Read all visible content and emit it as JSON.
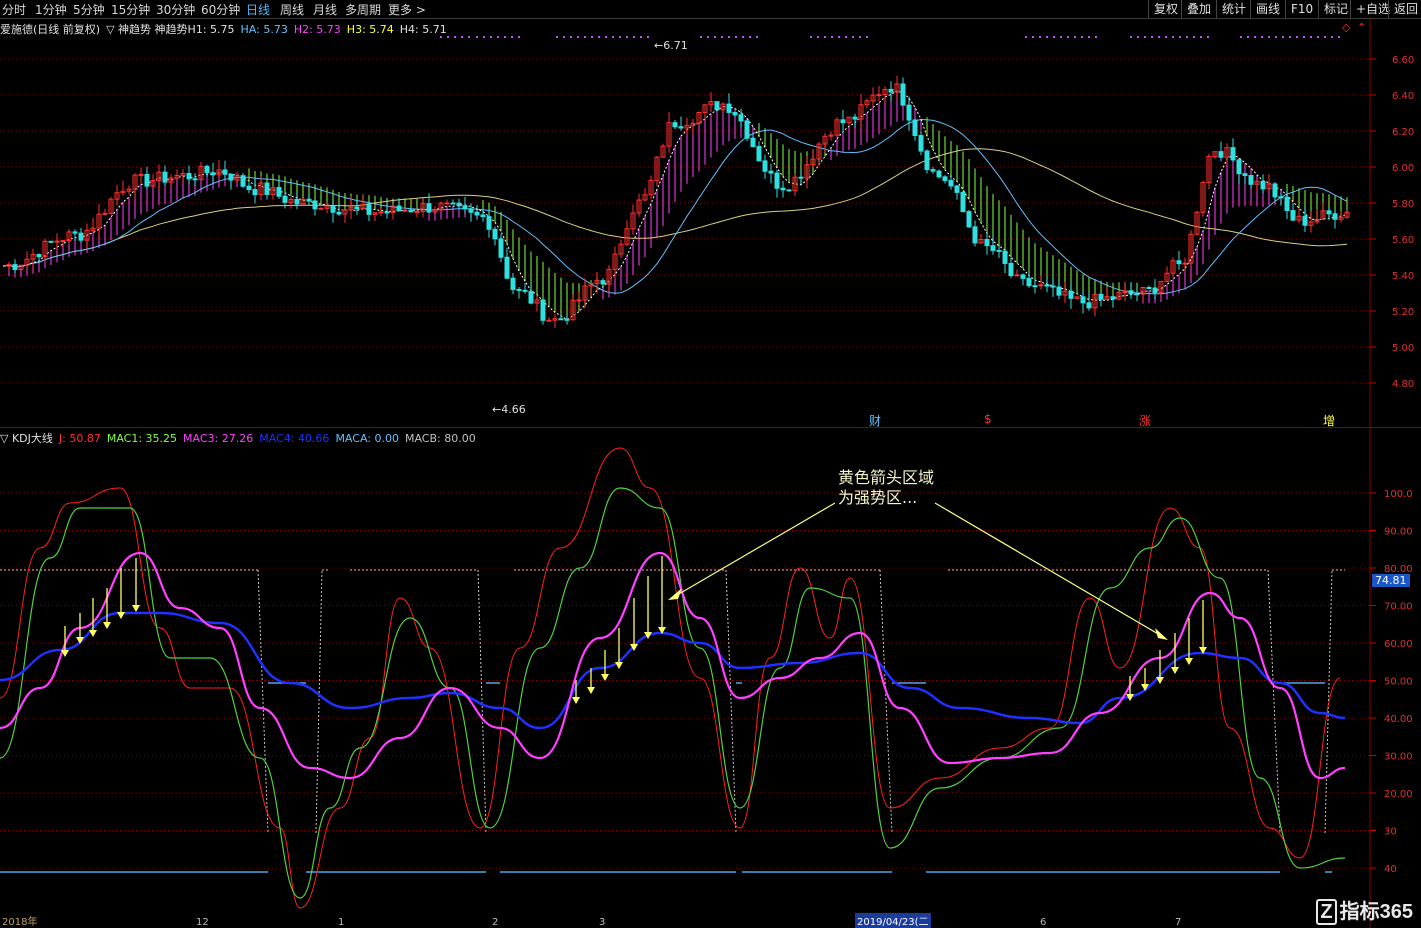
{
  "toolbar": {
    "periods": [
      "分时",
      "1分钟",
      "5分钟",
      "15分钟",
      "30分钟",
      "60分钟",
      "日线",
      "周线",
      "月线",
      "多周期",
      "更多 >"
    ],
    "active_period": "日线",
    "right_buttons": [
      "复权",
      "叠加",
      "统计",
      "画线",
      "F10",
      "标记",
      "+自选",
      "返回"
    ]
  },
  "main": {
    "legend": {
      "title": "爱施德(日线 前复权)",
      "indicator": "▽ 神趋势  神趋势H1: 5.75",
      "ha": "HA: 5.73",
      "h2": "H2: 5.73",
      "h3": "H3: 5.74",
      "h4": "H4: 5.71"
    },
    "price_labels": [
      "6.60",
      "6.40",
      "6.20",
      "6.00",
      "5.80",
      "5.60",
      "5.40",
      "5.20",
      "5.00",
      "4.80"
    ],
    "high_mark": "6.71",
    "low_mark": "4.66",
    "events": [
      "财",
      "$",
      "涨",
      "增"
    ]
  },
  "indicator": {
    "legend": {
      "name": "▽ KDJ大线",
      "j": "J: 50.87",
      "mac1": "MAC1: 35.25",
      "mac3": "MAC3: 27.26",
      "mac4": "MAC4: 40.66",
      "maca": "MACA: 0.00",
      "macb": "MACB: 80.00"
    },
    "axis_labels": [
      "100.0",
      "90.00",
      "80.00",
      "70.00",
      "60.00",
      "50.00",
      "40.00",
      "30.00",
      "20.00",
      "30",
      "40"
    ],
    "current_value": "74.81",
    "annotation_line1": "黄色箭头区域",
    "annotation_line2": "为强势区...",
    "x_labels": [
      "2018年",
      "12",
      "1",
      "2",
      "3",
      "2019/04/23(二",
      "6",
      "7"
    ]
  },
  "watermark": "指标365",
  "colors": {
    "up": "#ff3030",
    "down": "#30e0e0",
    "pink": "#ff40ff",
    "green_fill": "#80ff40",
    "yellow": "#ffff40",
    "blue": "#2030ff",
    "sky": "#60c0ff",
    "grid": "#8b0000"
  }
}
